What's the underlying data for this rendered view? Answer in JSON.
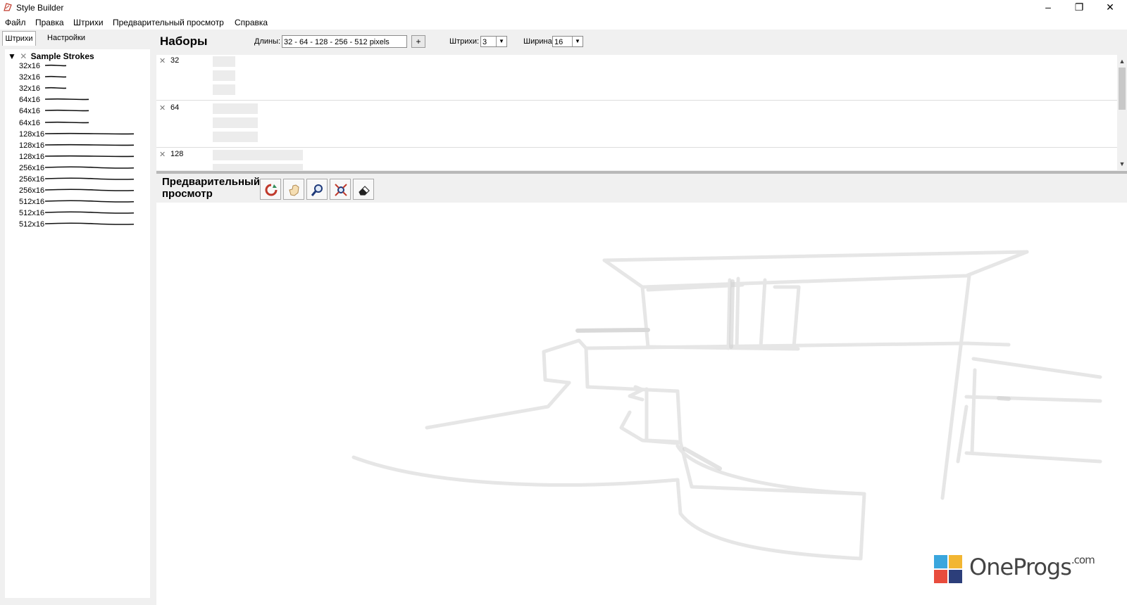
{
  "window": {
    "title": "Style Builder",
    "controls": [
      "–",
      "❐",
      "✕"
    ]
  },
  "menu": [
    "Файл",
    "Правка",
    "Штрихи",
    "Предварительный просмотр",
    "Справка"
  ],
  "left_tabs": [
    "Штрихи",
    "Настройки"
  ],
  "tree": {
    "root": "Sample Strokes",
    "items": [
      "32x16",
      "32x16",
      "32x16",
      "64x16",
      "64x16",
      "64x16",
      "128x16",
      "128x16",
      "128x16",
      "256x16",
      "256x16",
      "256x16",
      "512x16",
      "512x16",
      "512x16"
    ]
  },
  "sets": {
    "title": "Наборы",
    "lengths_label": "Длины:",
    "lengths_value": "32 - 64 - 128 - 256 - 512 pixels",
    "add_label": "+",
    "strokes_label": "Штрихи:",
    "strokes_value": "3",
    "width_label": "Ширина:",
    "width_value": "16",
    "rows": [
      {
        "label": "32"
      },
      {
        "label": "64"
      },
      {
        "label": "128"
      }
    ]
  },
  "preview": {
    "title": "Предварительный просмотр",
    "tools": [
      "rotate-icon",
      "hand-icon",
      "zoom-icon",
      "zoom-extents-icon",
      "eraser-icon"
    ]
  },
  "watermark": {
    "brand": "OneProgs",
    "suffix": ".com",
    "colors": [
      "#e84c3d",
      "#f2b632",
      "#3aa6dd",
      "#2c3e7a"
    ]
  }
}
